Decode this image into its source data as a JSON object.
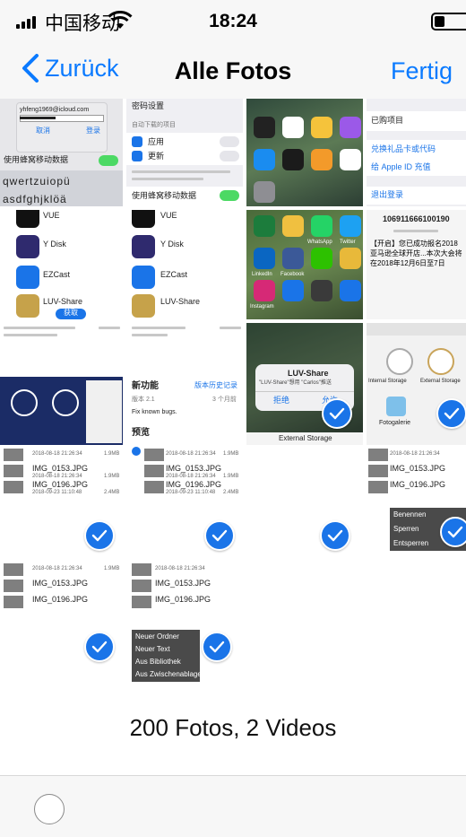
{
  "status": {
    "carrier": "中国移动",
    "time": "18:24",
    "battery_level": 0.3
  },
  "nav": {
    "back": "Zurück",
    "title": "Alle Fotos",
    "done": "Fertig"
  },
  "photos": {
    "p1": {
      "email": "yhfeng1969@icloud.com",
      "cancel": "取消",
      "login": "登录",
      "cellular": "使用蜂窝移动数据",
      "keys1": "qwertzuiopü",
      "keys2": "asdfghjklöä"
    },
    "p2": {
      "pwd": "密码设置",
      "auto_dl": "自动下载的项目",
      "apps": "应用",
      "updates": "更新",
      "cellular": "使用蜂窝移动数据"
    },
    "p4": {
      "purchased": "已购项目",
      "redeem": "兑换礼品卡或代码",
      "topup": "给 Apple ID 充值",
      "logout": "退出登录"
    },
    "p5": {
      "vue": "VUE",
      "ydisk": "Y Disk",
      "ezcast": "EZCast",
      "luv": "LUV-Share",
      "get": "获取"
    },
    "p6": {
      "vue": "VUE",
      "ydisk": "Y Disk",
      "ezcast": "EZCast",
      "luv": "LUV-Share"
    },
    "p7": {
      "wa": "WhatsApp",
      "tw": "Twitter",
      "fb": "Facebook",
      "ig": "Instagram",
      "in": "LinkedIn"
    },
    "p8": {
      "order": "106911666100190",
      "body": "【开启】您已成功报名2018亚马逊全球开店...本次大会将在2018年12月6日至7日"
    },
    "p11": {
      "title": "LUV-Share",
      "msg": "\"LUV-Share\"想用 \"Carlos\"推送",
      "deny": "拒绝",
      "allow": "允许",
      "ext": "External Storage"
    },
    "p12": {
      "internal": "Internal Storage",
      "external": "External Storage",
      "gallery": "Fotogalerie"
    },
    "p10": {
      "new_feat": "新功能",
      "history": "版本历史记录",
      "version": "版本 2.1",
      "months": "3 个月前",
      "fix": "Fix known bugs.",
      "preview": "预览"
    },
    "files": [
      {
        "name": "IMG_0153.JPG",
        "date": "2018-08-18 21:26:34",
        "size": "1.9MB"
      },
      {
        "name": "IMG_0196.JPG",
        "date": "2018-09-23 11:10:48",
        "size": "2.4MB"
      }
    ],
    "menu_a": [
      "Benennen",
      "Sperren",
      "Entsperren"
    ],
    "menu_b": [
      "Neuer Ordner",
      "Neuer Text",
      "Aus Bibliothek",
      "Aus Zwischenablage"
    ]
  },
  "summary": "200 Fotos, 2 Videos",
  "colors": {
    "accent": "#0a7aff",
    "check": "#1a74e8",
    "switch_on": "#4cd964"
  }
}
